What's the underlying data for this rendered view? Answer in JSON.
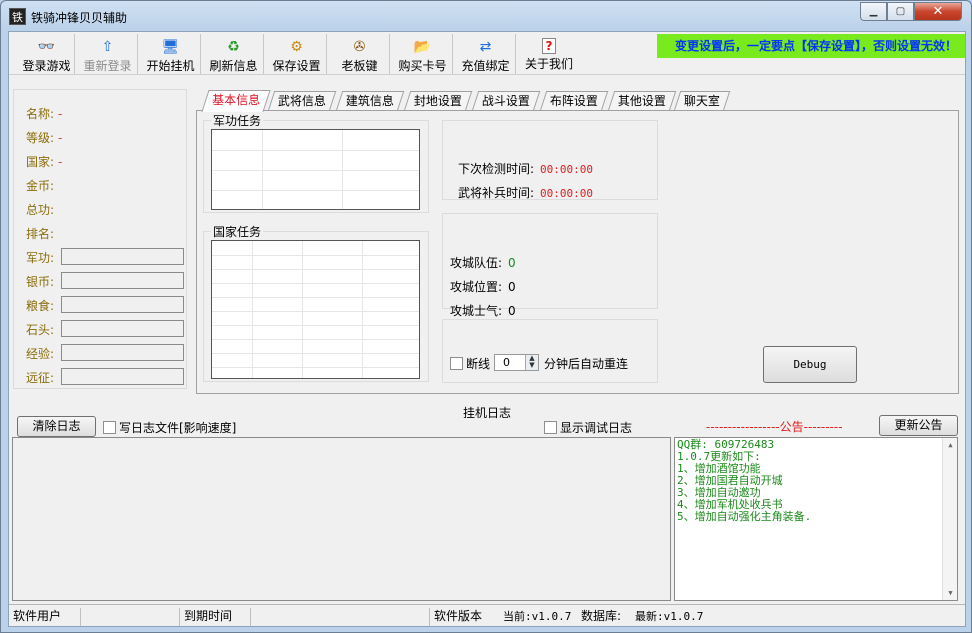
{
  "window": {
    "title": "铁骑冲锋贝贝辅助",
    "icon_char": "铁"
  },
  "toolbar": {
    "items": [
      {
        "label": "登录游戏",
        "icon": "login-icon",
        "glyph": "👓",
        "enabled": true
      },
      {
        "label": "重新登录",
        "icon": "relogin-icon",
        "glyph": "⇧",
        "enabled": false
      },
      {
        "label": "开始挂机",
        "icon": "computer-icon",
        "glyph": "🖥",
        "enabled": true
      },
      {
        "label": "刷新信息",
        "icon": "refresh-icon",
        "glyph": "♻",
        "enabled": true
      },
      {
        "label": "保存设置",
        "icon": "save-settings-icon",
        "glyph": "⚙",
        "enabled": true
      },
      {
        "label": "老板键",
        "icon": "boss-key-icon",
        "glyph": "✇",
        "enabled": true
      },
      {
        "label": "购买卡号",
        "icon": "buy-card-icon",
        "glyph": "📂",
        "enabled": true
      },
      {
        "label": "充值绑定",
        "icon": "recharge-icon",
        "glyph": "⇄",
        "enabled": true
      },
      {
        "label": "关于我们",
        "icon": "help-icon",
        "glyph": "?",
        "enabled": true
      }
    ],
    "notice": "变更设置后，一定要点【保存设置】，否则设置无效！"
  },
  "left_panel": {
    "name_label": "名称:",
    "name_value": "-",
    "level_label": "等级:",
    "level_value": "-",
    "country_label": "国家:",
    "country_value": "-",
    "gold_label": "金币:",
    "merit_label": "总功:",
    "rank_label": "排名:",
    "fields": [
      "军功:",
      "银币:",
      "粮食:",
      "石头:",
      "经验:",
      "远征:"
    ]
  },
  "tabs": [
    "基本信息",
    "武将信息",
    "建筑信息",
    "封地设置",
    "战斗设置",
    "布阵设置",
    "其他设置",
    "聊天室"
  ],
  "basic": {
    "military_task": "军功任务",
    "country_task": "国家任务",
    "next_check_label": "下次检测时间:",
    "next_check_value": "00:00:00",
    "replenish_label": "武将补兵时间:",
    "replenish_value": "00:00:00",
    "siege_team_label": "攻城队伍:",
    "siege_team_value": "0",
    "siege_pos_label": "攻城位置:",
    "siege_pos_value": "0",
    "siege_morale_label": "攻城士气:",
    "siege_morale_value": "0",
    "disconnect_label": "断线",
    "reconnect_minutes": "0",
    "reconnect_suffix": "分钟后自动重连",
    "debug_button": "Debug"
  },
  "log": {
    "title": "挂机日志",
    "clear_button": "清除日志",
    "write_file_label": "写日志文件[影响速度]",
    "show_debug_label": "显示调试日志",
    "announcement_header": "-----------------公告---------",
    "update_button": "更新公告",
    "announcement_lines": [
      "QQ群: 609726483",
      "1.0.7更新如下:",
      "1、增加酒馆功能",
      "2、增加国君自动开城",
      "3、增加自动邀功",
      "4、增加军机处收兵书",
      "5、增加自动强化主角装备."
    ]
  },
  "statusbar": {
    "user_label": "软件用户",
    "expire_label": "到期时间",
    "version_label": "软件版本",
    "current_version": "当前:v1.0.7",
    "db_label": "数据库:",
    "latest_version": "最新:v1.0.7"
  }
}
